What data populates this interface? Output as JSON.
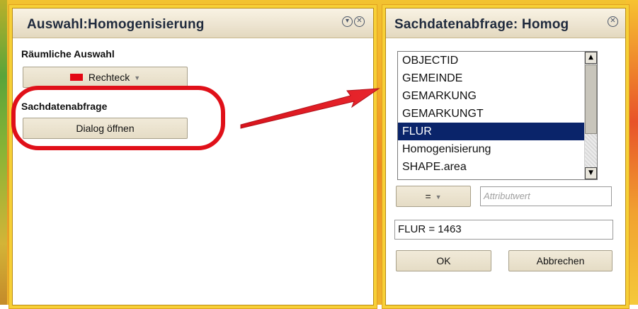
{
  "panel_search": {
    "title": "Auswahl:Homogenisierung",
    "spatial_label": "Räumliche Auswahl",
    "spatial_button": "Rechteck",
    "attr_label": "Sachdatenabfrage",
    "attr_button": "Dialog öffnen"
  },
  "panel_dialog": {
    "title": "Sachdatenabfrage: Homog",
    "fields": [
      "OBJECTID",
      "GEMEINDE",
      "GEMARKUNG",
      "GEMARKUNGT",
      "FLUR",
      "Homogenisierung",
      "SHAPE.area"
    ],
    "selected_index": 4,
    "operator": "=",
    "value_placeholder": "Attributwert",
    "query": "FLUR = 1463",
    "ok_label": "OK",
    "cancel_label": "Abbrechen"
  },
  "icons": {
    "collapse": "collapse-circle-icon",
    "close": "close-circle-icon",
    "scroll_up": "scroll-up-icon",
    "scroll_down": "scroll-down-icon",
    "dropdown": "chevron-down-icon",
    "arrow": "annotation-arrow"
  },
  "colors": {
    "accent_red": "#e30613",
    "selection": "#0a246a",
    "frame": "#f7d037"
  }
}
